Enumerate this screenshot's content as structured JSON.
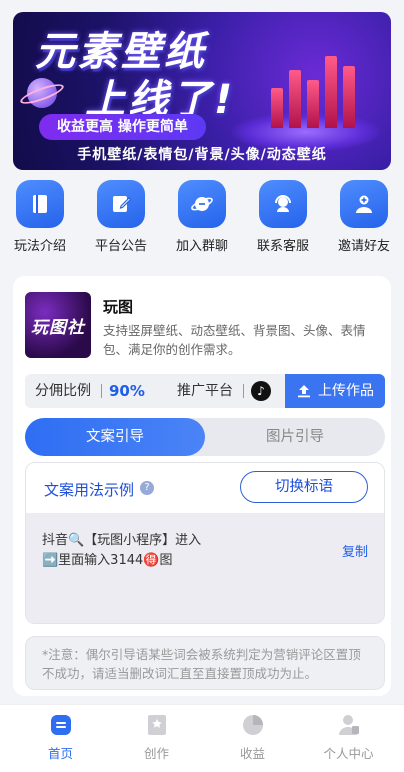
{
  "banner": {
    "title_line1": "元素壁纸",
    "title_line2": "上线了!",
    "pill": "收益更高 操作更简单",
    "subline": "手机壁纸/表情包/背景/头像/动态壁纸"
  },
  "quick_links": [
    {
      "label": "玩法介绍",
      "icon": "book-icon"
    },
    {
      "label": "平台公告",
      "icon": "edit-note-icon"
    },
    {
      "label": "加入群聊",
      "icon": "planet-chat-icon"
    },
    {
      "label": "联系客服",
      "icon": "headset-icon"
    },
    {
      "label": "邀请好友",
      "icon": "add-friend-icon"
    }
  ],
  "app": {
    "thumb_text": "玩图社",
    "name": "玩图",
    "description": "支持竖屏壁纸、动态壁纸、背景图、头像、表情包、满足你的创作需求。"
  },
  "stats": {
    "commission_label": "分佣比例",
    "commission_value": "90%",
    "platform_label": "推广平台",
    "platform_icon": "tiktok-icon",
    "upload_label": "上传作品"
  },
  "tabs": [
    {
      "label": "文案引导",
      "active": true
    },
    {
      "label": "图片引导",
      "active": false
    }
  ],
  "copy_section": {
    "title": "文案用法示例",
    "help_icon": "?",
    "switch_label": "切换标语",
    "text_line1": "抖音🔍【玩图小程序】进入",
    "text_line2": "➡️里面输入3144🉐图",
    "copy_label": "复制"
  },
  "notice": "*注意：偶尔引导语某些词会被系统判定为营销评论区置顶不成功，请适当删改词汇直至直接置顶成功为止。",
  "nav": [
    {
      "label": "首页",
      "active": true,
      "icon": "home-icon"
    },
    {
      "label": "创作",
      "active": false,
      "icon": "create-icon"
    },
    {
      "label": "收益",
      "active": false,
      "icon": "earnings-icon"
    },
    {
      "label": "个人中心",
      "active": false,
      "icon": "profile-icon"
    }
  ],
  "colors": {
    "accent": "#2f6ef3",
    "banner_bg": "#1b1266"
  }
}
